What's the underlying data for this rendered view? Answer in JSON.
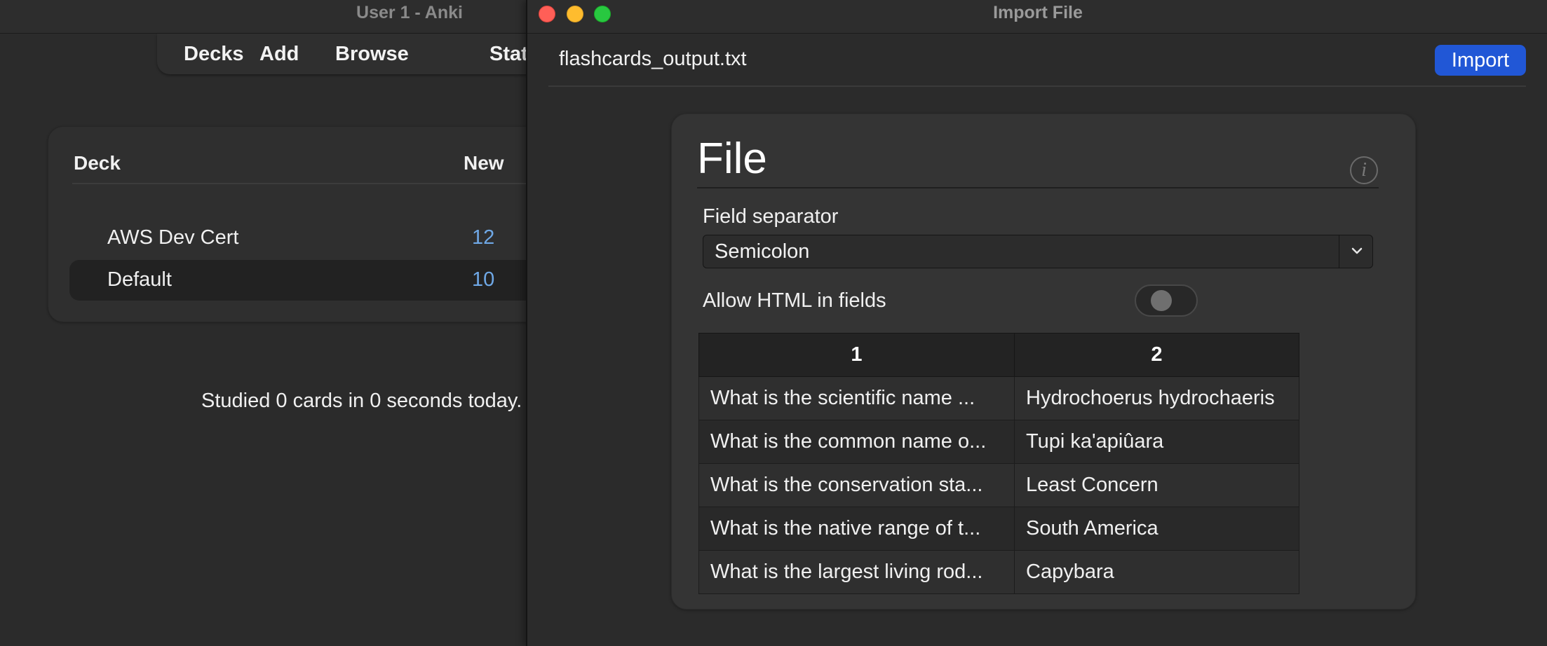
{
  "main_window": {
    "title": "User 1 - Anki",
    "toolbar": [
      "Decks",
      "Add",
      "Browse",
      "Stats"
    ],
    "deck_table": {
      "headers": {
        "deck": "Deck",
        "new": "New"
      },
      "rows": [
        {
          "name": "AWS Dev Cert",
          "new": "12",
          "selected": false
        },
        {
          "name": "Default",
          "new": "10",
          "selected": true
        }
      ]
    },
    "studied_text": "Studied 0 cards in 0 seconds today."
  },
  "dialog": {
    "title": "Import File",
    "filename": "flashcards_output.txt",
    "import_label": "Import",
    "section_title": "File",
    "field_separator": {
      "label": "Field separator",
      "value": "Semicolon"
    },
    "allow_html": {
      "label": "Allow HTML in fields",
      "checked": false
    },
    "preview": {
      "columns": [
        "1",
        "2"
      ],
      "rows": [
        [
          "What is the scientific name ...",
          "Hydrochoerus hydrochaeris"
        ],
        [
          "What is the common name o...",
          "Tupi ka'apiûara"
        ],
        [
          "What is the conservation sta...",
          "Least Concern"
        ],
        [
          "What is the native range of t...",
          "South America"
        ],
        [
          "What is the largest living rod...",
          "Capybara"
        ]
      ]
    }
  },
  "colors": {
    "accent": "#2157d6",
    "new_count": "#6fa8e6",
    "close": "#ff5f57",
    "minimize": "#febc2e",
    "maximize": "#28c840"
  },
  "icons": {
    "info": "info-icon",
    "select_chevron": "chevron-down-icon"
  }
}
